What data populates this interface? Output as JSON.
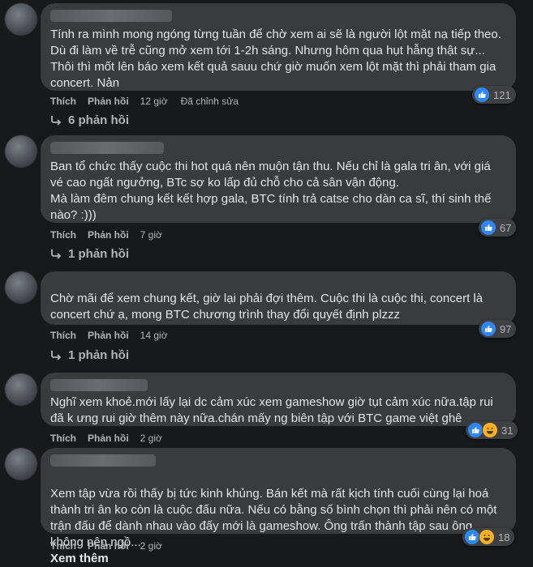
{
  "comments": [
    {
      "text": "Tính ra mình mong ngóng từng tuần để chờ xem ai sẽ là người lột mặt nạ tiếp theo. Dù đi làm về trễ cũng mở xem tới 1-2h sáng. Nhưng hôm qua hụt hẫng thật sự... Thôi thì mốt lên báo xem kết quả sauu chứ giờ muốn xem lột mặt thì phải tham gia concert. Nản",
      "like_label": "Thích",
      "reply_label": "Phản hồi",
      "time": "12 giờ",
      "edited": "Đã chỉnh sửa",
      "reaction_count": "121",
      "replies": "6 phản hồi"
    },
    {
      "text": "Ban tổ chức thấy cuộc thi hot quá nên muộn tận thu. Nếu chỉ là gala tri ân, với giá vé cao ngất ngưởng, BTc sợ ko lấp đủ chỗ cho cả sân vận động.\nMà làm đêm chung kết kết hợp gala, BTC tính trả catse cho dàn ca sĩ, thí sinh thế nào? :)))",
      "like_label": "Thích",
      "reply_label": "Phản hồi",
      "time": "7 giờ",
      "reaction_count": "67",
      "replies": "1 phản hồi"
    },
    {
      "text": "Chờ mãi để xem chung kết, giờ lại phải đợi thêm. Cuộc thi là cuộc thi, concert là concert chứ ạ, mong BTC chương trình thay đổi quyết định plzzz",
      "like_label": "Thích",
      "reply_label": "Phản hồi",
      "time": "14 giờ",
      "reaction_count": "97",
      "replies": "1 phản hồi"
    },
    {
      "text": "Nghĩ xem khoẻ.mới lấy lại dc cảm xúc xem gameshow giờ tụt cảm xúc nữa.tập rui đã k ưng rui giờ thêm này nữa.chán mấy ng biên tập với BTC game việt ghê",
      "like_label": "Thích",
      "reply_label": "Phản hồi",
      "time": "2 giờ",
      "reaction_count": "31"
    },
    {
      "text": "Xem tập vừa rồi thấy bị tức kinh khủng. Bán kết mà rất kịch tính cuối cùng lại hoá thành tri ân ko còn là cuộc đấu nữa. Nếu có bằng số bình chọn thì phải nên có một trận đấu để dành nhau vào đấy mới là gameshow. Ông trấn thành tập sau ông không nên ngồ...",
      "more": "Xem thêm",
      "like_label": "Thích",
      "reply_label": "Phản hồi",
      "time": "2 giờ",
      "reaction_count": "18"
    }
  ]
}
